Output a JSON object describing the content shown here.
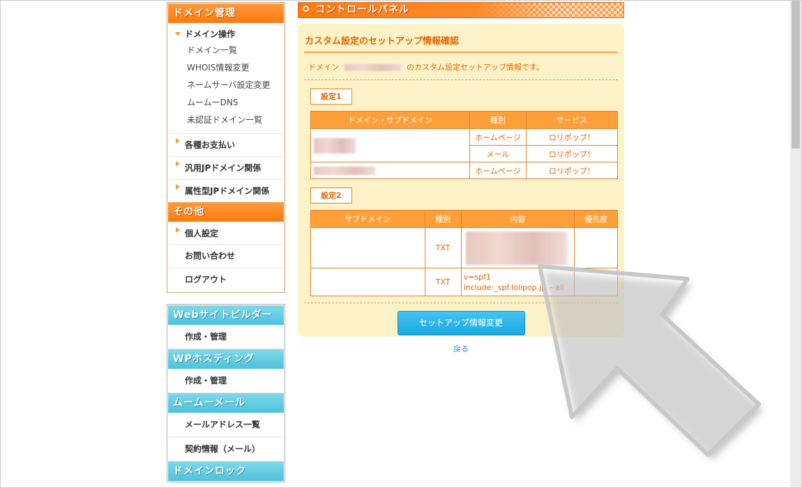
{
  "sidebar": {
    "domain_header": "ドメイン管理",
    "domain_ops": {
      "label": "ドメイン操作",
      "items": [
        "ドメイン一覧",
        "WHOIS情報変更",
        "ネームサーバ設定変更",
        "ムームーDNS",
        "未認証ドメイン一覧"
      ]
    },
    "categories": [
      "各種お支払い",
      "汎用JPドメイン関係",
      "属性型JPドメイン関係"
    ],
    "other_header": "その他",
    "other_items": [
      "個人設定",
      "お問い合わせ",
      "ログアウト"
    ],
    "blue_sections": [
      {
        "header": "Webサイトビルダー",
        "items": [
          "作成・管理"
        ]
      },
      {
        "header": "WPホスティング",
        "items": [
          "作成・管理"
        ]
      },
      {
        "header": "ムームーメール",
        "items": [
          "メールアドレス一覧",
          "契約情報（メール）"
        ]
      },
      {
        "header": "ドメインロック",
        "items": []
      }
    ]
  },
  "main": {
    "header_title": "コントロールパネル",
    "panel_title": "カスタム設定のセットアップ情報確認",
    "intro_prefix": "ドメイン",
    "intro_suffix": "のカスタム設定セットアップ情報です。",
    "setting1": {
      "label": "設定1",
      "columns": [
        "ドメイン・サブドメイン",
        "種別",
        "サービス"
      ],
      "rows": [
        {
          "type": "ホームページ",
          "service": "ロリポップ！"
        },
        {
          "type": "メール",
          "service": "ロリポップ！"
        },
        {
          "type": "ホームページ",
          "service": "ロリポップ！"
        }
      ]
    },
    "setting2": {
      "label": "設定2",
      "columns": [
        "サブドメイン",
        "種別",
        "内容",
        "優先度"
      ],
      "rows": [
        {
          "type": "TXT",
          "content": ""
        },
        {
          "type": "TXT",
          "content": "v=spf1 include:_spf.lolipop.jp ~all"
        }
      ]
    },
    "primary_button": "セットアップ情報変更",
    "back_link": "戻る"
  },
  "colors": {
    "orange_header": "#ff7a0e",
    "blue_header": "#4ec2dc",
    "panel_bg": "#fef3c8",
    "table_header": "#ff9f3a",
    "button": "#18a8e0"
  }
}
